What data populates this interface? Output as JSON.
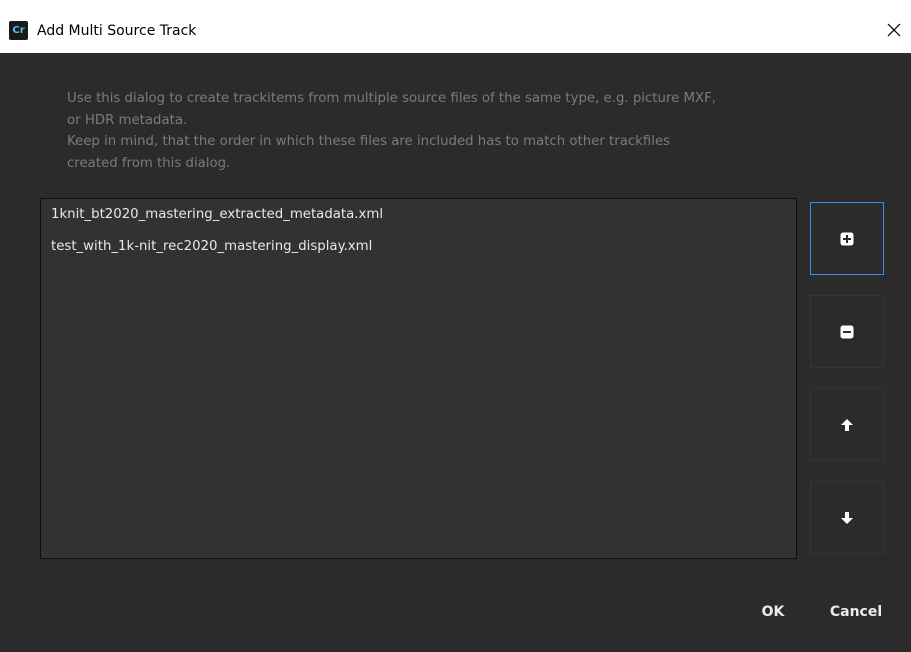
{
  "window": {
    "title": "Add Multi Source Track",
    "app_icon_text": "Cr",
    "close_icon": "close-icon"
  },
  "description": {
    "line1": "Use this dialog to create trackitems from multiple source files of the same type, e.g. picture MXF,",
    "line2": "or HDR metadata.",
    "line3": "Keep in mind, that the order in which these files are included has to match other trackfiles",
    "line4": "created from this dialog."
  },
  "files": [
    "1knit_bt2020_mastering_extracted_metadata.xml",
    "test_with_1k-nit_rec2020_mastering_display.xml"
  ],
  "side_buttons": [
    {
      "icon": "add-icon"
    },
    {
      "icon": "remove-icon"
    },
    {
      "icon": "arrow-up-icon"
    },
    {
      "icon": "arrow-down-icon"
    }
  ],
  "footer": {
    "ok_label": "OK",
    "cancel_label": "Cancel"
  },
  "colors": {
    "background": "#2b2b2b",
    "list_background": "#323232",
    "focus_border": "#3a8ee6",
    "description_text": "#7b7b7b"
  }
}
